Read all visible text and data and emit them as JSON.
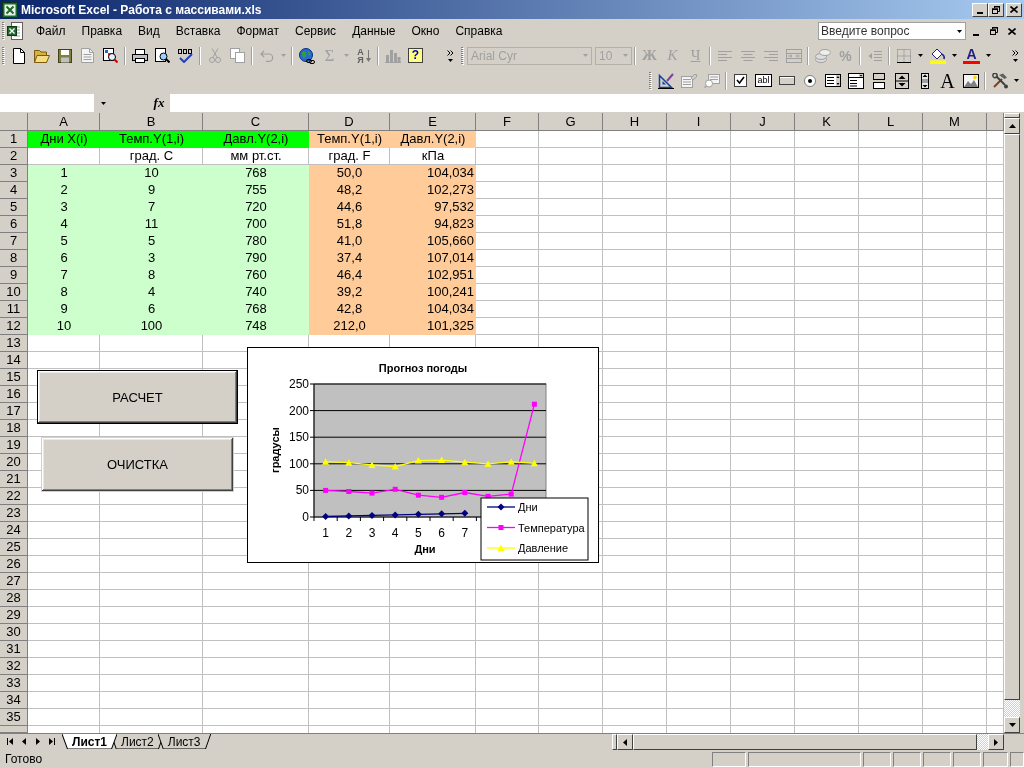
{
  "window": {
    "title": "Microsoft Excel - Работа с массивами.xls"
  },
  "menu": {
    "items": [
      "Файл",
      "Правка",
      "Вид",
      "Вставка",
      "Формат",
      "Сервис",
      "Данные",
      "Окно",
      "Справка"
    ],
    "help_box": {
      "placeholder": "Введите вопрос"
    }
  },
  "toolbars": [
    {
      "groups": [
        [
          {
            "kind": "new",
            "disabled": false
          },
          {
            "kind": "open",
            "disabled": false
          },
          {
            "kind": "save",
            "disabled": false
          },
          {
            "kind": "permission",
            "disabled": true
          },
          {
            "kind": "search",
            "disabled": false
          }
        ],
        [
          {
            "kind": "print",
            "disabled": false
          },
          {
            "kind": "preview",
            "disabled": false
          },
          {
            "kind": "spelling",
            "disabled": false
          }
        ],
        [
          {
            "kind": "cut",
            "disabled": true
          },
          {
            "kind": "copy",
            "disabled": true
          }
        ],
        [
          {
            "kind": "undo",
            "disabled": true
          },
          {
            "kind": "dropdown",
            "disabled": true
          }
        ],
        [
          {
            "kind": "hyperlink",
            "disabled": false
          },
          {
            "kind": "autosum",
            "label": "Σ",
            "disabled": true
          },
          {
            "kind": "dropdown",
            "disabled": true
          },
          {
            "kind": "sort",
            "label": "А Я",
            "disabled": true
          }
        ],
        [
          {
            "kind": "chart",
            "disabled": true
          },
          {
            "kind": "help",
            "label": "?",
            "disabled": false
          },
          {
            "kind": "more",
            "disabled": false
          }
        ]
      ]
    },
    {
      "groups": [
        [
          {
            "kind": "font_name",
            "value": "Arial Cyr",
            "disabled": true
          },
          {
            "kind": "font_size",
            "value": "10",
            "disabled": true
          }
        ],
        [
          {
            "kind": "bold",
            "label": "Ж",
            "disabled": true
          },
          {
            "kind": "italic",
            "label": "К",
            "disabled": true
          },
          {
            "kind": "underline",
            "label": "Ч",
            "disabled": true
          }
        ],
        [
          {
            "kind": "align_left",
            "disabled": true
          },
          {
            "kind": "align_center",
            "disabled": true
          },
          {
            "kind": "align_right",
            "disabled": true
          },
          {
            "kind": "merge",
            "disabled": true
          }
        ],
        [
          {
            "kind": "currency",
            "disabled": true
          },
          {
            "kind": "percent",
            "label": "%",
            "disabled": true
          }
        ],
        [
          {
            "kind": "outdent",
            "disabled": true
          }
        ],
        [
          {
            "kind": "borders",
            "disabled": false
          },
          {
            "kind": "dropdown",
            "disabled": false
          },
          {
            "kind": "fill",
            "disabled": false
          },
          {
            "kind": "dropdown",
            "disabled": false
          },
          {
            "kind": "font_color",
            "label": "A",
            "disabled": false
          },
          {
            "kind": "dropdown",
            "disabled": false
          },
          {
            "kind": "more",
            "disabled": false
          }
        ]
      ]
    },
    {
      "groups": [
        [
          {
            "kind": "design",
            "disabled": false
          },
          {
            "kind": "properties",
            "disabled": true
          },
          {
            "kind": "code",
            "disabled": true
          }
        ],
        [
          {
            "kind": "checkbox",
            "disabled": false
          },
          {
            "kind": "textbox",
            "label": "abl",
            "disabled": false
          },
          {
            "kind": "command",
            "disabled": false
          },
          {
            "kind": "option",
            "disabled": false
          },
          {
            "kind": "listbox",
            "disabled": false
          },
          {
            "kind": "combobox",
            "disabled": false
          },
          {
            "kind": "toggle",
            "disabled": false
          },
          {
            "kind": "spin",
            "disabled": false
          },
          {
            "kind": "scrollbar",
            "disabled": false
          },
          {
            "kind": "label",
            "label": "A",
            "disabled": false
          },
          {
            "kind": "image",
            "disabled": false
          }
        ],
        [
          {
            "kind": "tools",
            "disabled": false
          },
          {
            "kind": "dropdown",
            "disabled": false
          }
        ]
      ]
    }
  ],
  "formula_bar": {
    "function_button": "fx"
  },
  "sheet": {
    "columns": [
      "A",
      "B",
      "C",
      "D",
      "E",
      "F",
      "G",
      "H",
      "I",
      "J",
      "K",
      "L",
      "M"
    ],
    "rows": [
      {
        "header": "1",
        "cells": [
          {
            "text": "Дни X(i)",
            "color": "#00ff00"
          },
          {
            "text": "Темп.Y(1,i)",
            "color": "#00ff00"
          },
          {
            "text": "Давл.Y(2,i)",
            "color": "#00ff00"
          },
          {
            "text": "Темп.Y(1,i)",
            "color": "#ffcc99"
          },
          {
            "text": "Давл.Y(2,i)",
            "color": "#ffcc99"
          }
        ]
      },
      {
        "header": "2",
        "cells": [
          {},
          {
            "text": "град. C"
          },
          {
            "text": "мм рт.ст."
          },
          {
            "text": "град. F"
          },
          {
            "text": "кПа"
          }
        ]
      },
      {
        "header": "3",
        "cells": [
          {
            "text": "1",
            "color": "#ccffcc"
          },
          {
            "text": "10",
            "color": "#ccffcc"
          },
          {
            "text": "768",
            "color": "#ccffcc"
          },
          {
            "text": "50,0",
            "color": "#ffcc99"
          },
          {
            "text": "104,034",
            "color": "#ffcc99"
          }
        ]
      },
      {
        "header": "4",
        "cells": [
          {
            "text": "2",
            "color": "#ccffcc"
          },
          {
            "text": "9",
            "color": "#ccffcc"
          },
          {
            "text": "755",
            "color": "#ccffcc"
          },
          {
            "text": "48,2",
            "color": "#ffcc99"
          },
          {
            "text": "102,273",
            "color": "#ffcc99"
          }
        ]
      },
      {
        "header": "5",
        "cells": [
          {
            "text": "3",
            "color": "#ccffcc"
          },
          {
            "text": "7",
            "color": "#ccffcc"
          },
          {
            "text": "720",
            "color": "#ccffcc"
          },
          {
            "text": "44,6",
            "color": "#ffcc99"
          },
          {
            "text": "97,532",
            "color": "#ffcc99"
          }
        ]
      },
      {
        "header": "6",
        "cells": [
          {
            "text": "4",
            "color": "#ccffcc"
          },
          {
            "text": "11",
            "color": "#ccffcc"
          },
          {
            "text": "700",
            "color": "#ccffcc"
          },
          {
            "text": "51,8",
            "color": "#ffcc99"
          },
          {
            "text": "94,823",
            "color": "#ffcc99"
          }
        ]
      },
      {
        "header": "7",
        "cells": [
          {
            "text": "5",
            "color": "#ccffcc"
          },
          {
            "text": "5",
            "color": "#ccffcc"
          },
          {
            "text": "780",
            "color": "#ccffcc"
          },
          {
            "text": "41,0",
            "color": "#ffcc99"
          },
          {
            "text": "105,660",
            "color": "#ffcc99"
          }
        ]
      },
      {
        "header": "8",
        "cells": [
          {
            "text": "6",
            "color": "#ccffcc"
          },
          {
            "text": "3",
            "color": "#ccffcc"
          },
          {
            "text": "790",
            "color": "#ccffcc"
          },
          {
            "text": "37,4",
            "color": "#ffcc99"
          },
          {
            "text": "107,014",
            "color": "#ffcc99"
          }
        ]
      },
      {
        "header": "9",
        "cells": [
          {
            "text": "7",
            "color": "#ccffcc"
          },
          {
            "text": "8",
            "color": "#ccffcc"
          },
          {
            "text": "760",
            "color": "#ccffcc"
          },
          {
            "text": "46,4",
            "color": "#ffcc99"
          },
          {
            "text": "102,951",
            "color": "#ffcc99"
          }
        ]
      },
      {
        "header": "10",
        "cells": [
          {
            "text": "8",
            "color": "#ccffcc"
          },
          {
            "text": "4",
            "color": "#ccffcc"
          },
          {
            "text": "740",
            "color": "#ccffcc"
          },
          {
            "text": "39,2",
            "color": "#ffcc99"
          },
          {
            "text": "100,241",
            "color": "#ffcc99"
          }
        ]
      },
      {
        "header": "11",
        "cells": [
          {
            "text": "9",
            "color": "#ccffcc"
          },
          {
            "text": "6",
            "color": "#ccffcc"
          },
          {
            "text": "768",
            "color": "#ccffcc"
          },
          {
            "text": "42,8",
            "color": "#ffcc99"
          },
          {
            "text": "104,034",
            "color": "#ffcc99"
          }
        ]
      },
      {
        "header": "12",
        "cells": [
          {
            "text": "10",
            "color": "#ccffcc"
          },
          {
            "text": "100",
            "color": "#ccffcc"
          },
          {
            "text": "748",
            "color": "#ccffcc"
          },
          {
            "text": "212,0",
            "color": "#ffcc99"
          },
          {
            "text": "101,325",
            "color": "#ffcc99"
          }
        ]
      },
      {
        "header": "13"
      },
      {
        "header": "14"
      },
      {
        "header": "15"
      },
      {
        "header": "16"
      },
      {
        "header": "17"
      },
      {
        "header": "18"
      },
      {
        "header": "19"
      },
      {
        "header": "20"
      },
      {
        "header": "21"
      },
      {
        "header": "22"
      },
      {
        "header": "23"
      },
      {
        "header": "24"
      },
      {
        "header": "25"
      },
      {
        "header": "26"
      },
      {
        "header": "27"
      },
      {
        "header": "28"
      },
      {
        "header": "29"
      },
      {
        "header": "30"
      },
      {
        "header": "31"
      },
      {
        "header": "32"
      },
      {
        "header": "33"
      },
      {
        "header": "34"
      },
      {
        "header": "35"
      }
    ],
    "buttons": [
      {
        "label": "РАСЧЕТ",
        "focused": true
      },
      {
        "label": "ОЧИСТКА",
        "focused": false
      }
    ],
    "chart": {
      "chart_data": {
        "type": "line",
        "title": "Прогноз погоды",
        "xlabel": "Дни",
        "ylabel": "градусы",
        "x": [
          1,
          2,
          3,
          4,
          5,
          6,
          7,
          8,
          9,
          10
        ],
        "xlim": [
          0.5,
          10.5
        ],
        "xticks": [
          {
            "value": 1,
            "label": "1"
          },
          {
            "value": 2,
            "label": "2"
          },
          {
            "value": 3,
            "label": "3"
          },
          {
            "value": 4,
            "label": "4"
          },
          {
            "value": 5,
            "label": "5"
          },
          {
            "value": 6,
            "label": "6"
          },
          {
            "value": 7,
            "label": "7"
          }
        ],
        "ylim": [
          0,
          250
        ],
        "yticks": [
          {
            "value": 0,
            "label": "0"
          },
          {
            "value": 50,
            "label": "50"
          },
          {
            "value": 100,
            "label": "100"
          },
          {
            "value": 150,
            "label": "150"
          },
          {
            "value": 200,
            "label": "200"
          },
          {
            "value": 250,
            "label": "250"
          }
        ],
        "grid": true,
        "legend": "lower right",
        "series": [
          {
            "name": "Дни",
            "color": "#000080",
            "marker": "diamond",
            "values": [
              1,
              2,
              3,
              4,
              5,
              6,
              7,
              null,
              null,
              null
            ]
          },
          {
            "name": "Температура",
            "color": "#ff00ff",
            "marker": "square",
            "values": [
              50,
              48,
              45,
              52,
              41,
              37,
              46,
              39,
              43,
              212
            ]
          },
          {
            "name": "Давление",
            "color": "#ffff00",
            "marker": "triangle",
            "values": [
              104,
              102,
              98,
              95,
              106,
              107,
              103,
              100,
              104,
              101
            ]
          }
        ]
      }
    }
  },
  "sheet_tabs": [
    {
      "label": "Лист1",
      "selected": true
    },
    {
      "label": "Лист2",
      "selected": false
    },
    {
      "label": "Лист3",
      "selected": false
    }
  ],
  "status_bar": {
    "text": "Готово"
  }
}
